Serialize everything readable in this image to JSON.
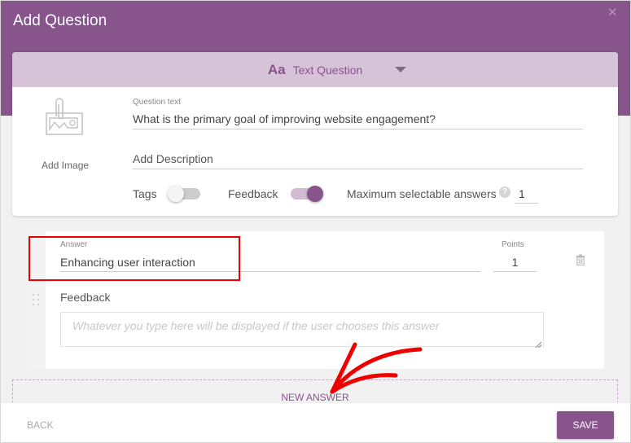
{
  "dialog": {
    "title": "Add Question",
    "close_icon": "close-icon"
  },
  "question_type": {
    "icon_text": "Aa",
    "selected": "Text Question"
  },
  "question": {
    "add_image_label": "Add Image",
    "question_text_label": "Question text",
    "question_text_value": "What is the primary goal of improving website engagement?",
    "description_placeholder": "Add Description",
    "tags_label": "Tags",
    "tags_enabled": false,
    "feedback_label": "Feedback",
    "feedback_enabled": true,
    "max_answers_label": "Maximum selectable answers",
    "help_icon_text": "?",
    "max_answers_value": "1"
  },
  "answer": {
    "answer_label": "Answer",
    "answer_value": "Enhancing user interaction",
    "points_label": "Points",
    "points_value": "1",
    "feedback_label": "Feedback",
    "feedback_placeholder": "Whatever you type here will be displayed if the user chooses this answer"
  },
  "new_answer_label": "NEW ANSWER",
  "footer": {
    "back_label": "BACK",
    "save_label": "SAVE"
  },
  "colors": {
    "accent": "#87548c",
    "accent_light": "#d6c3d8",
    "annotation_red": "#ee0000"
  }
}
